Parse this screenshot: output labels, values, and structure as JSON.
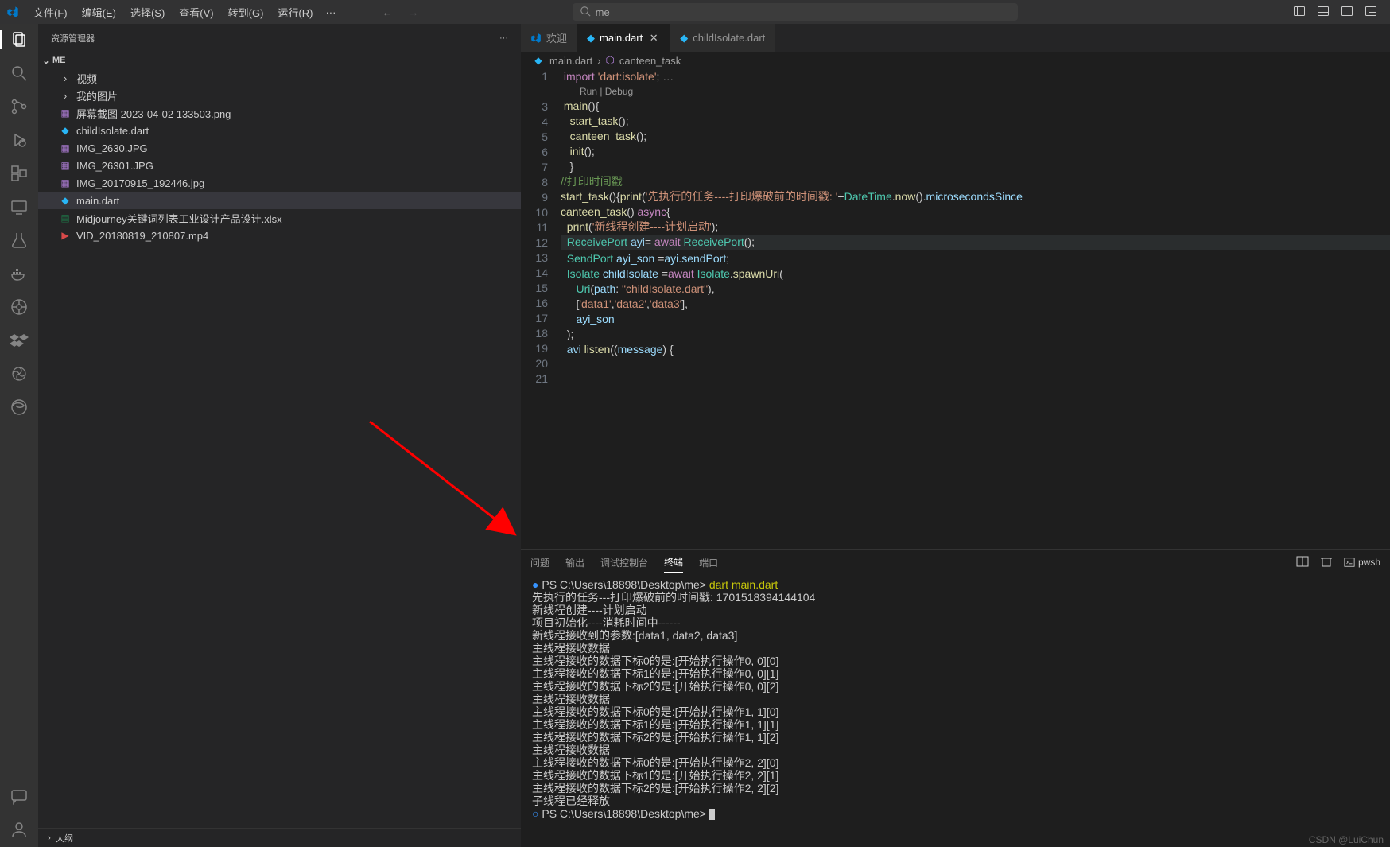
{
  "menu": [
    "文件(F)",
    "编辑(E)",
    "选择(S)",
    "查看(V)",
    "转到(G)",
    "运行(R)"
  ],
  "search_value": "me",
  "sidebar": {
    "title": "资源管理器",
    "root": "ME",
    "folders": [
      "视频",
      "我的图片"
    ],
    "files": [
      {
        "name": "屏幕截图 2023-04-02 133503.png",
        "icon": "img"
      },
      {
        "name": "childIsolate.dart",
        "icon": "dart"
      },
      {
        "name": "IMG_2630.JPG",
        "icon": "img"
      },
      {
        "name": "IMG_26301.JPG",
        "icon": "img"
      },
      {
        "name": "IMG_20170915_192446.jpg",
        "icon": "img"
      },
      {
        "name": "main.dart",
        "icon": "dart",
        "selected": true
      },
      {
        "name": "Midjourney关键词列表工业设计产品设计.xlsx",
        "icon": "xlsx"
      },
      {
        "name": "VID_20180819_210807.mp4",
        "icon": "vid"
      }
    ],
    "outline_label": "大纲"
  },
  "tabs": [
    {
      "label": "欢迎",
      "icon": "vs",
      "active": false
    },
    {
      "label": "main.dart",
      "icon": "dart",
      "active": true,
      "close": true
    },
    {
      "label": "childIsolate.dart",
      "icon": "dart",
      "active": false
    }
  ],
  "breadcrumb": {
    "file": "main.dart",
    "symbol": "canteen_task"
  },
  "codelens": "Run | Debug",
  "code": {
    "lines": [
      {
        "n": 1,
        "html": "<span class='tk-keyword'>import</span> <span class='tk-string'>'dart:isolate'</span>; <span style='color:#888'>…</span>"
      },
      {
        "n": 3,
        "html": "<span class='tk-func'>main</span>(){"
      },
      {
        "n": 4,
        "html": "  <span class='tk-func'>start_task</span>();"
      },
      {
        "n": 5,
        "html": "  <span class='tk-func'>canteen_task</span>();"
      },
      {
        "n": 6,
        "html": "  <span class='tk-func'>init</span>();"
      },
      {
        "n": 7,
        "html": "  }"
      },
      {
        "n": 8,
        "html": ""
      },
      {
        "n": 9,
        "html": "<span class='tk-comment'>//打印时间戳</span>"
      },
      {
        "n": 10,
        "html": "<span class='tk-func'>start_task</span>(){<span class='tk-func'>print</span>(<span class='tk-string'>'先执行的任务----打印爆破前的时间戳: '</span>+<span class='tk-type'>DateTime</span>.<span class='tk-func'>now</span>().<span class='tk-prop'>microsecondsSince</span>"
      },
      {
        "n": 11,
        "html": "<span class='tk-func'>canteen_task</span>() <span class='tk-keyword'>async</span>{"
      },
      {
        "n": 12,
        "html": "  <span class='tk-func'>print</span>(<span class='tk-string'>'新线程创建----计划启动'</span>);"
      },
      {
        "n": 13,
        "html": "  <span class='tk-type'>ReceivePort</span> <span class='tk-var'>ayi</span>= <span class='tk-await'>await</span> <span class='tk-type'>ReceivePort</span>();",
        "hl": true
      },
      {
        "n": 14,
        "html": "  <span class='tk-type'>SendPort</span> <span class='tk-var'>ayi_son</span> =<span class='tk-var'>ayi</span>.<span class='tk-prop'>sendPort</span>;"
      },
      {
        "n": 15,
        "html": "  <span class='tk-type'>Isolate</span> <span class='tk-var'>childIsolate</span> =<span class='tk-await'>await</span> <span class='tk-type'>Isolate</span>.<span class='tk-func'>spawnUri</span>("
      },
      {
        "n": 16,
        "html": "     <span class='tk-type'>Uri</span>(<span class='tk-prop'>path</span>: <span class='tk-string'>\"childIsolate.dart\"</span>),"
      },
      {
        "n": 17,
        "html": "     [<span class='tk-string'>'data1'</span>,<span class='tk-string'>'data2'</span>,<span class='tk-string'>'data3'</span>],"
      },
      {
        "n": 18,
        "html": "     <span class='tk-var'>ayi_son</span>"
      },
      {
        "n": 19,
        "html": "  );"
      },
      {
        "n": 20,
        "html": ""
      },
      {
        "n": 21,
        "html": "  <span class='tk-var'>avi</span> <span class='tk-func'>listen</span>((<span class='tk-var'>message</span>) {"
      }
    ]
  },
  "panel": {
    "tabs": [
      "问题",
      "输出",
      "调试控制台",
      "终端",
      "端口"
    ],
    "active": "终端",
    "shell": "pwsh",
    "terminal": [
      {
        "type": "prompt",
        "prefix": "● ",
        "path": "PS C:\\Users\\18898\\Desktop\\me>",
        "cmd": "dart main.dart"
      },
      {
        "type": "out",
        "text": "先执行的任务---打印爆破前的时间戳: 1701518394144104"
      },
      {
        "type": "out",
        "text": "新线程创建----计划启动"
      },
      {
        "type": "out",
        "text": "项目初始化----消耗时间中------"
      },
      {
        "type": "out",
        "text": "新线程接收到的参数:[data1, data2, data3]"
      },
      {
        "type": "out",
        "text": "主线程接收数据"
      },
      {
        "type": "out",
        "text": "主线程接收的数据下标0的是:[开始执行操作0, 0][0]"
      },
      {
        "type": "out",
        "text": "主线程接收的数据下标1的是:[开始执行操作0, 0][1]"
      },
      {
        "type": "out",
        "text": "主线程接收的数据下标2的是:[开始执行操作0, 0][2]"
      },
      {
        "type": "out",
        "text": "主线程接收数据"
      },
      {
        "type": "out",
        "text": "主线程接收的数据下标0的是:[开始执行操作1, 1][0]"
      },
      {
        "type": "out",
        "text": "主线程接收的数据下标1的是:[开始执行操作1, 1][1]"
      },
      {
        "type": "out",
        "text": "主线程接收的数据下标2的是:[开始执行操作1, 1][2]"
      },
      {
        "type": "out",
        "text": "主线程接收数据"
      },
      {
        "type": "out",
        "text": "主线程接收的数据下标0的是:[开始执行操作2, 2][0]"
      },
      {
        "type": "out",
        "text": "主线程接收的数据下标1的是:[开始执行操作2, 2][1]"
      },
      {
        "type": "out",
        "text": "主线程接收的数据下标2的是:[开始执行操作2, 2][2]"
      },
      {
        "type": "out",
        "text": "子线程已经释放"
      },
      {
        "type": "prompt",
        "prefix": "○ ",
        "path": "PS C:\\Users\\18898\\Desktop\\me>",
        "cmd": "",
        "cursor": true
      }
    ]
  },
  "watermark": "CSDN @LuiChun"
}
